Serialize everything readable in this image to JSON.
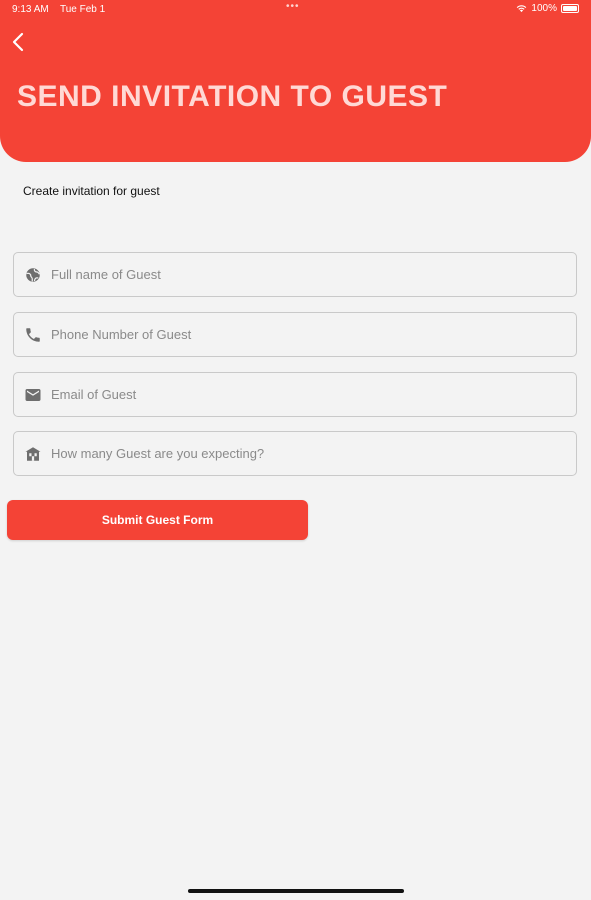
{
  "status_bar": {
    "time": "9:13 AM",
    "date": "Tue Feb 1",
    "dots": "•••",
    "battery": "100%"
  },
  "header": {
    "title": "SEND INVITATION TO GUEST",
    "back_icon": "chevron-left-icon",
    "background": "#f44336"
  },
  "subtitle": "Create invitation for guest",
  "form": {
    "fields": [
      {
        "icon": "globe-icon",
        "placeholder": "Full name of Guest",
        "value": ""
      },
      {
        "icon": "phone-icon",
        "placeholder": "Phone Number of Guest",
        "value": ""
      },
      {
        "icon": "mail-icon",
        "placeholder": "Email of Guest",
        "value": ""
      },
      {
        "icon": "home-icon",
        "placeholder": "How many Guest are you expecting?",
        "value": ""
      }
    ],
    "submit_label": "Submit Guest Form"
  }
}
